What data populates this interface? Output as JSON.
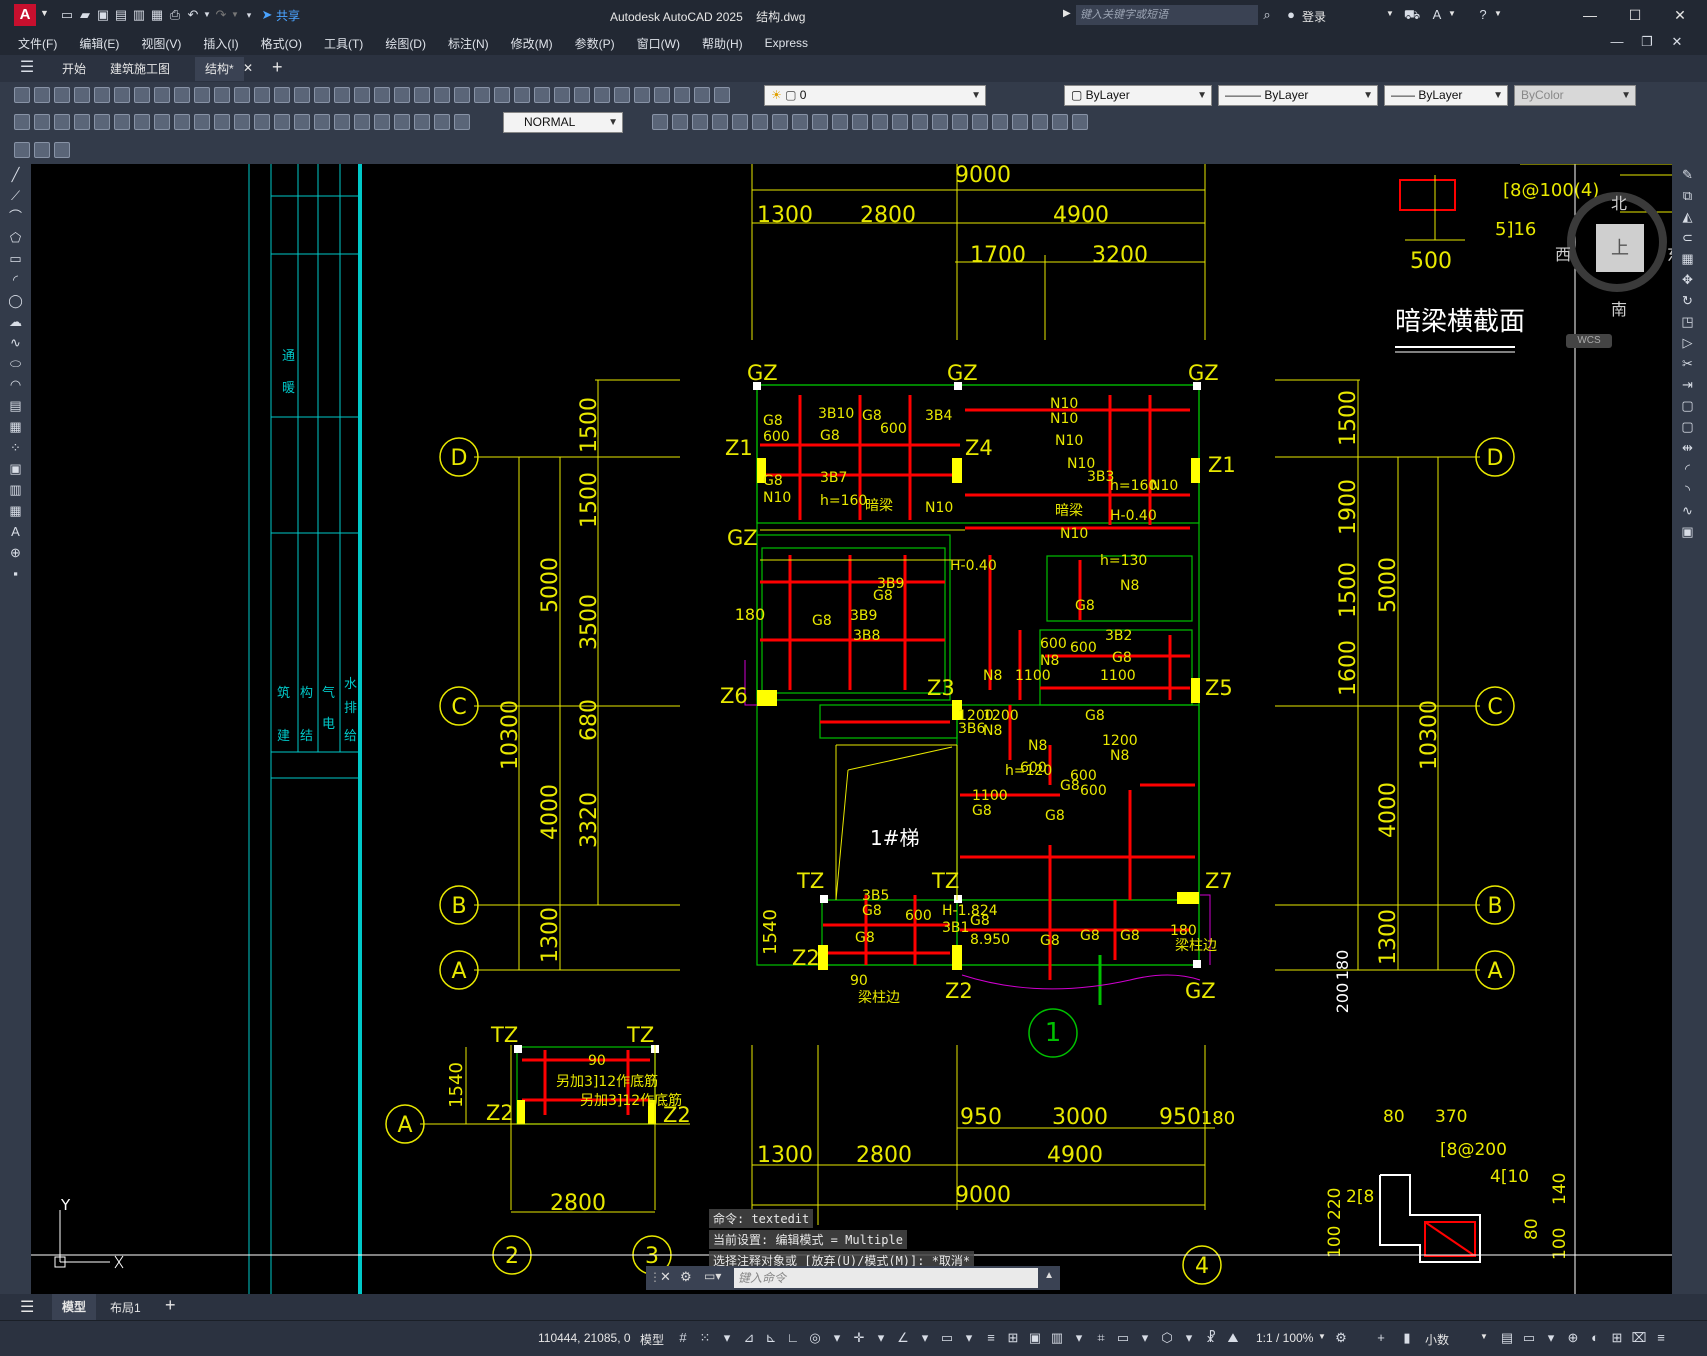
{
  "app": {
    "title": "Autodesk AutoCAD 2025",
    "file": "结构.dwg",
    "logo": "A",
    "share": "共享",
    "search_placeholder": "键入关键字或短语",
    "login": "登录"
  },
  "menu": [
    "文件(F)",
    "编辑(E)",
    "视图(V)",
    "插入(I)",
    "格式(O)",
    "工具(T)",
    "绘图(D)",
    "标注(N)",
    "修改(M)",
    "参数(P)",
    "窗口(W)",
    "帮助(H)",
    "Express"
  ],
  "doc_tabs": [
    "开始",
    "建筑施工图",
    "结构*"
  ],
  "toolbar": {
    "layer_value": "0",
    "color": "ByLayer",
    "linetype": "ByLayer",
    "lineweight": "ByLayer",
    "plotstyle": "ByColor",
    "dimstyle": "NORMAL"
  },
  "viewcube": {
    "north": "北",
    "south": "南",
    "east": "东",
    "west": "西",
    "top": "上",
    "wcs": "WCS"
  },
  "drawing": {
    "top_dims": [
      "9000",
      "1300",
      "2800",
      "4900",
      "1700",
      "3200"
    ],
    "bottom_dims": [
      "950",
      "3000",
      "950",
      "180",
      "1300",
      "2800",
      "4900",
      "9000"
    ],
    "left_dims": [
      "1500",
      "1500",
      "5000",
      "3500",
      "680",
      "10300",
      "4000",
      "3320",
      "1300",
      "1540",
      "180"
    ],
    "right_dims": [
      "1500",
      "1900",
      "1500",
      "5000",
      "1600",
      "10300",
      "4000",
      "1300",
      "200",
      "180"
    ],
    "grid_left": [
      "D",
      "C",
      "B",
      "A"
    ],
    "grid_right": [
      "D",
      "C",
      "B",
      "A"
    ],
    "grid_bottom": [
      "2",
      "3",
      "4",
      "1"
    ],
    "section_title": "暗梁横截面",
    "section_labels": [
      "[8@100(4)",
      "5]16",
      "500"
    ],
    "detail_labels": [
      "80",
      "370",
      "[8@200",
      "2[8",
      "4[10",
      "220",
      "100",
      "140",
      "80",
      "100"
    ],
    "stair_label": "1#梯",
    "column_labels": [
      "GZ",
      "GZ",
      "GZ",
      "Z1",
      "Z4",
      "Z1",
      "GZ",
      "Z6",
      "Z3",
      "Z5",
      "TZ",
      "TZ",
      "Z7",
      "Z2",
      "Z2",
      "GZ",
      "TZ",
      "TZ",
      "Z2",
      "Z2"
    ],
    "rebar_labels": [
      "G8",
      "600",
      "3B10",
      "G8",
      "G8",
      "600",
      "3B4",
      "G8",
      "N10",
      "3B7",
      "h=160",
      "暗梁",
      "N10",
      "N10",
      "N10",
      "N10",
      "N10",
      "3B3",
      "h=160",
      "N10",
      "暗梁",
      "N10",
      "H-0.40",
      "3B9",
      "G8",
      "H-0.40",
      "3B9",
      "G8",
      "3B8",
      "h=130",
      "N8",
      "G8",
      "600",
      "3B2",
      "G8",
      "600",
      "N8",
      "1100",
      "1100",
      "N8",
      "1200",
      "N8",
      "1200",
      "3B6",
      "h=120",
      "N8",
      "1200",
      "N8",
      "1100",
      "G8",
      "600",
      "G8",
      "G8",
      "600",
      "G8",
      "600",
      "3B5",
      "G8",
      "G8",
      "600",
      "H-1.824",
      "3B1",
      "G8",
      "8.950",
      "G8",
      "G8",
      "G8",
      "180",
      "梁柱边",
      "90",
      "梁柱边",
      "90",
      "另加3]12作底筋",
      "另加3]12作底筋"
    ],
    "table_labels": [
      "暖",
      "通",
      "建",
      "筑",
      "结",
      "构",
      "电",
      "气",
      "给",
      "排",
      "水"
    ],
    "ucs_y": "Y"
  },
  "command": {
    "history": [
      "命令:  textedit",
      "当前设置: 编辑模式 = Multiple",
      "选择注释对象或 [放弃(U)/模式(M)]: *取消*"
    ],
    "placeholder": "键入命令"
  },
  "layouts": [
    "模型",
    "布局1"
  ],
  "status": {
    "coords": "110444, 21085, 0",
    "space": "模型",
    "scale": "1:1 / 100%",
    "units": "小数"
  }
}
